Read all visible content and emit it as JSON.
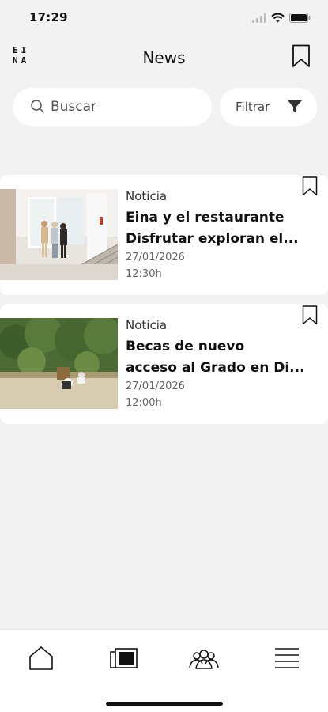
{
  "status_bar": {
    "time": "17:29"
  },
  "header": {
    "logo_line1": "EI",
    "logo_line2": "NA",
    "title": "News"
  },
  "search": {
    "placeholder": "Buscar"
  },
  "filter": {
    "label": "Filtrar"
  },
  "news": [
    {
      "category": "Noticia",
      "title_line1": "Eina y el restaurante",
      "title_line2": "Disfrutar exploran el...",
      "date": "27/01/2026",
      "time": "12:30h"
    },
    {
      "category": "Noticia",
      "title_line1": "Becas de nuevo",
      "title_line2": "acceso al Grado en Di...",
      "date": "27/01/2026",
      "time": "12:00h"
    }
  ],
  "tabs": [
    "home-icon",
    "news-icon",
    "community-icon",
    "menu-icon"
  ],
  "colors": {
    "background": "#f2f2f2",
    "card": "#ffffff",
    "text": "#111111"
  }
}
